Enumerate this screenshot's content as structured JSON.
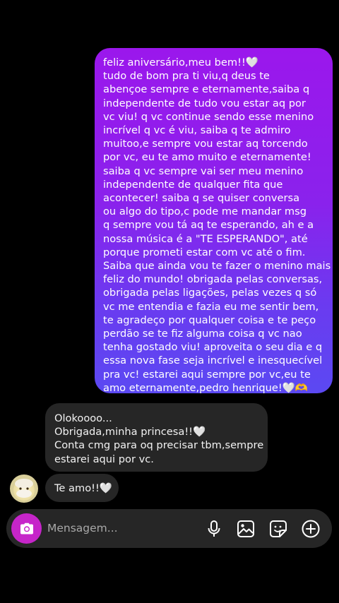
{
  "sent_message": {
    "lines": [
      "feliz aniversário,meu bem!!🤍",
      "tudo de bom pra ti viu,q deus te",
      "abençoe sempre e eternamente,saiba q",
      "independente de tudo vou estar aq por",
      "vc viu! q vc continue sendo esse menino",
      "incrível q vc é viu, saiba q te admiro",
      "muitoo,e sempre vou estar aq torcendo",
      "por vc, eu te amo muito e eternamente!",
      "saiba q vc sempre vai ser meu menino",
      "independente de qualquer fita que",
      "acontecer! saiba q se quiser conversa",
      "ou algo do tipo,c pode me mandar msg",
      "q sempre vou tá aq te esperando, ah e a",
      "nossa música é a \"TE ESPERANDO\", até",
      "porque prometi estar com vc até o fim.",
      "Saiba que ainda vou te fazer o menino mais",
      "feliz do mundo! obrigada pelas conversas,",
      "obrigada pelas ligações, pelas vezes q só",
      "vc me entendia e fazia eu me sentir bem,",
      "te agradeço por qualquer coisa e te peço",
      "perdão se te fiz alguma coisa q vc nao",
      "tenha gostado viu! aproveita o seu dia e q",
      "essa nova fase seja incrível e inesquecível",
      "pra vc! estarei aqui sempre por vc,eu te",
      "amo eternamente,pedro henrique!🤍🫶"
    ]
  },
  "received_messages": [
    {
      "lines": [
        "Olokoooo...",
        "Obrigada,minha princesa!!🤍",
        "Conta cmg para oq precisar tbm,sempre",
        "estarei aqui por vc."
      ]
    },
    {
      "lines": [
        "Te amo!!🤍"
      ]
    }
  ],
  "composer": {
    "placeholder": "Mensagem...",
    "camera_icon": "camera-icon",
    "mic_icon": "microphone-icon",
    "gallery_icon": "image-icon",
    "sticker_icon": "sticker-icon",
    "plus_icon": "plus-circle-icon"
  },
  "colors": {
    "background": "#000000",
    "sent_gradient_top": "#9b17ec",
    "sent_gradient_bottom": "#5b49f2",
    "received_bubble": "#262626",
    "camera_button": "#c625c9"
  }
}
